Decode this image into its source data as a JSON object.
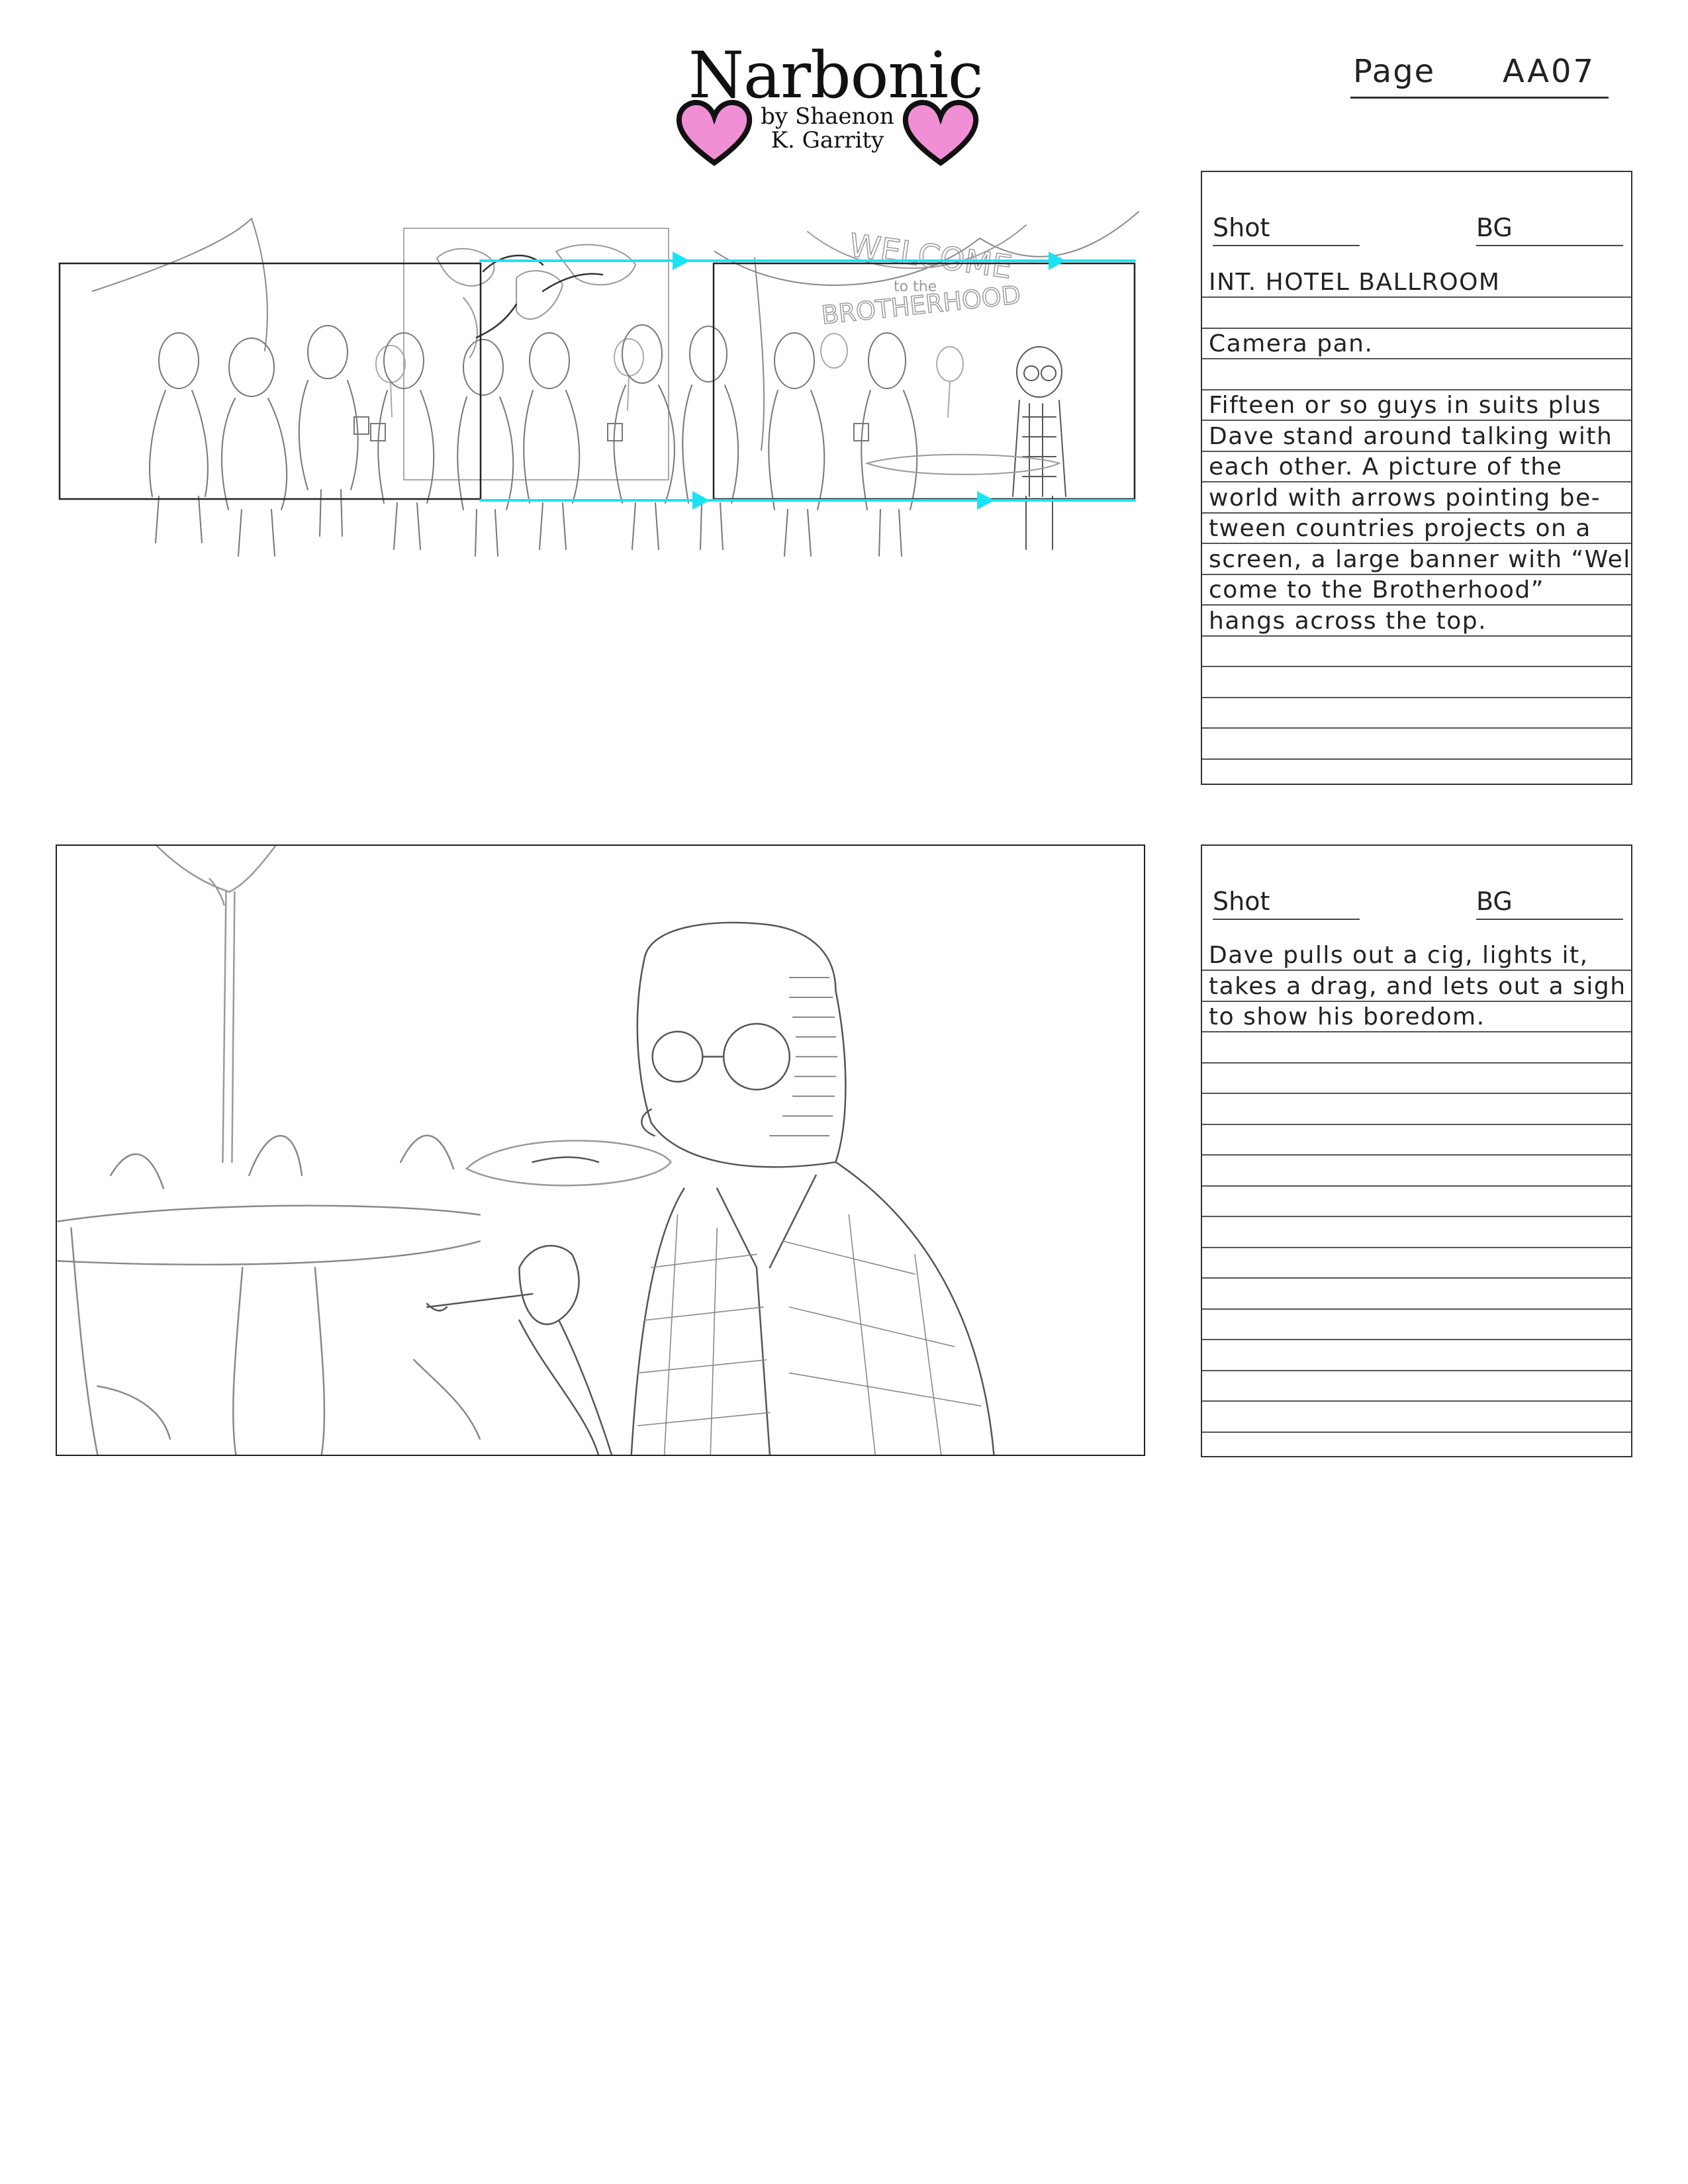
{
  "header": {
    "logo_title": "Narbonic",
    "logo_byline_1": "by Shaenon",
    "logo_byline_2": "K. Garrity",
    "page_label": "Page",
    "page_value": "AA07",
    "heart_color": "#f08fd3"
  },
  "panel1": {
    "banner_text_1": "WELCOME",
    "banner_text_2": "to the",
    "banner_text_3": "BROTHERHOOD",
    "pan_arrow_color": "#19e3f5"
  },
  "shots": [
    {
      "shot_label": "Shot",
      "bg_label": "BG",
      "notes": [
        "INT. HOTEL BALLROOM",
        "",
        "Camera pan.",
        "",
        "Fifteen or so guys in suits plus",
        "Dave stand around talking with",
        "each other. A picture of the",
        "world with arrows pointing be-",
        "tween countries projects on a",
        "screen, a large banner with “Wel-",
        "come to the Brotherhood”",
        "hangs across the top."
      ]
    },
    {
      "shot_label": "Shot",
      "bg_label": "BG",
      "notes": [
        "Dave pulls out a cig, lights it,",
        "takes a drag, and lets out a sigh",
        "to show his boredom."
      ]
    }
  ]
}
